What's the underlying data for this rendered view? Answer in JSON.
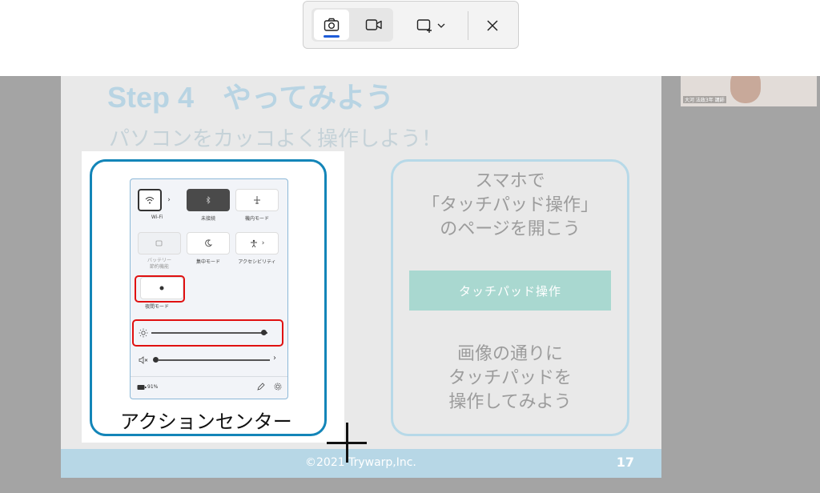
{
  "toolbar": {
    "camera_icon": "camera-icon",
    "video_icon": "video-icon",
    "snip_mode_icon": "rectangle-snip-icon",
    "close_icon": "close-icon",
    "accent": "#1d5bd8"
  },
  "slide": {
    "title": "Step 4　やってみよう",
    "subtitle": "パソコンをカッコよく操作しよう！",
    "left_caption": "アクションセンター",
    "right_top_line1": "スマホで",
    "right_top_line2": "「タッチパッド操作」",
    "right_top_line3": "のページを開こう",
    "right_button": "タッチパッド操作",
    "right_bottom_line1": "画像の通りに",
    "right_bottom_line2": "タッチパッドを",
    "right_bottom_line3": "操作してみよう",
    "copyright": "©2021 Trywarp,Inc.",
    "page_number": "17"
  },
  "action_center": {
    "tiles": [
      {
        "label": "Wi-Fi"
      },
      {
        "label": "未接続"
      },
      {
        "label": "機内モード"
      },
      {
        "label": "バッテリー\n節約機能"
      },
      {
        "label": "集中モード"
      },
      {
        "label": "アクセシビリティ"
      },
      {
        "label": "夜間モード"
      }
    ],
    "brightness_level": 0.93,
    "volume_level": 0.0,
    "battery": "91%"
  },
  "participant": {
    "name": "大河 法政3年 講師"
  }
}
